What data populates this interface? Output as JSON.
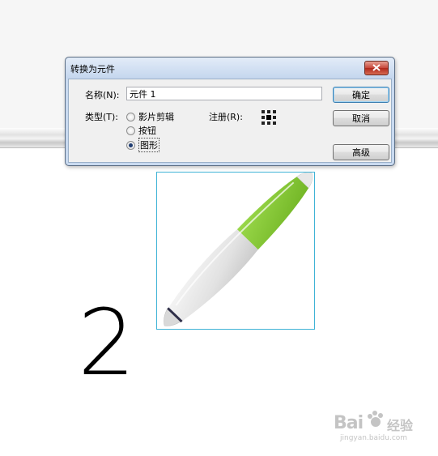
{
  "dialog": {
    "title": "转换为元件",
    "name_label": "名称(N):",
    "name_value": "元件 1",
    "type_label": "类型(T):",
    "types": [
      {
        "label": "影片剪辑",
        "checked": false
      },
      {
        "label": "按钮",
        "checked": false
      },
      {
        "label": "图形",
        "checked": true
      }
    ],
    "registration_label": "注册(R):",
    "buttons": {
      "ok": "确定",
      "cancel": "取消",
      "advanced": "高级"
    }
  },
  "canvas": {
    "step_number": "2",
    "watermark": {
      "brand": "Bai",
      "brand_cn": "经验",
      "url": "jingyan.baidu.com"
    }
  },
  "colors": {
    "pen_green": "#7fc42e",
    "pen_body": "#e6e6e6",
    "selection_border": "#3fb3d6",
    "close_button": "#c6463a"
  }
}
